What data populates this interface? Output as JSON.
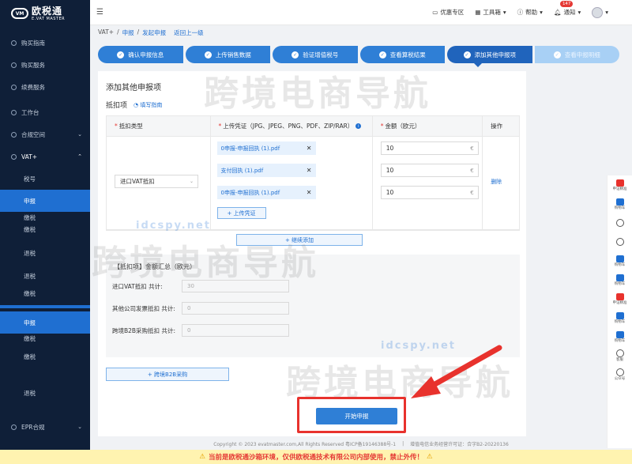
{
  "brand": {
    "mark": "VM",
    "name_cn": "欧税通",
    "name_en": "E.VAT MASTER"
  },
  "sidebar": {
    "items": [
      {
        "label": "购买指南"
      },
      {
        "label": "购买服务"
      },
      {
        "label": "续费服务"
      },
      {
        "label": "工作台"
      },
      {
        "label": "合规空间"
      },
      {
        "label": "VAT+"
      }
    ],
    "sub_items": [
      {
        "label": "税号"
      },
      {
        "label": "申报"
      },
      {
        "label": "缴税"
      },
      {
        "label": "缴税"
      },
      {
        "label": "退税"
      },
      {
        "label": "退税"
      },
      {
        "label": "缴税"
      },
      {
        "label": "申报"
      },
      {
        "label": "缴税"
      },
      {
        "label": "缴税"
      },
      {
        "label": "退税"
      }
    ],
    "bottom_item": {
      "label": "EPR合规"
    }
  },
  "topbar": {
    "promo": "优惠专区",
    "toolbox": "工具箱",
    "help": "帮助",
    "notify": "通知",
    "notify_count": "147"
  },
  "breadcrumb": {
    "root": "VAT+",
    "level1": "申报",
    "level2": "发起申报",
    "back": "返回上一级",
    "sep": "/"
  },
  "steps": [
    {
      "label": "确认申报信息",
      "state": "done"
    },
    {
      "label": "上传销售数据",
      "state": "done"
    },
    {
      "label": "验证增值税号",
      "state": "done"
    },
    {
      "label": "查看算税结果",
      "state": "done"
    },
    {
      "label": "添加其他申报项",
      "state": "current"
    },
    {
      "label": "查看申报明细",
      "state": "pending"
    }
  ],
  "card": {
    "title": "添加其他申报项",
    "section_title": "抵扣项",
    "guide_link": "填写指南"
  },
  "table": {
    "headers": {
      "type": "抵扣类型",
      "upload": "上传凭证（JPG、JPEG、PNG、PDF、ZIP/RAR）",
      "amount": "金额（欧元）",
      "action": "操作"
    },
    "row": {
      "type_value": "进口VAT抵扣",
      "files": [
        "0申报-申报回执 (1).pdf",
        "支付回执 (1).pdf",
        "0申报-申报回执 (1).pdf"
      ],
      "amounts": [
        "10",
        "10",
        "10"
      ],
      "unit": "€",
      "upload_label": "+ 上传凭证",
      "delete_label": "删除"
    },
    "add_label": "+ 继续添加"
  },
  "summary": {
    "title": "【抵扣项】金额汇总（欧元）",
    "rows": [
      {
        "label": "进口VAT抵扣 共计:",
        "value": "30"
      },
      {
        "label": "其他公司发票抵扣 共计:",
        "value": "0"
      },
      {
        "label": "跨境B2B采购抵扣 共计:",
        "value": "0"
      }
    ]
  },
  "b2b_button": "+ 跨境B2B采购",
  "submit_button": "开始申报",
  "footer": {
    "copyright": "Copyright © 2023 evatmaster.com,All Rights Reserved 粤ICP备19146388号-1",
    "license": "增值电信业务经营许可证：合字B2-20220136",
    "sep": "|"
  },
  "warning": {
    "icon_left": "⚠",
    "text": "当前是欧税通沙箱环境，仅供欧税通技术有限公司内部使用，禁止外传！",
    "icon_right": "⚠"
  },
  "float_bar": {
    "items": [
      "申证精准",
      "购物车",
      "",
      "",
      "购物车",
      "购物车",
      "申证精准",
      "购物车",
      "购物车",
      "客服",
      "公众号"
    ]
  },
  "watermarks": {
    "big": "跨境电商导航",
    "small": "idcspy.net"
  }
}
